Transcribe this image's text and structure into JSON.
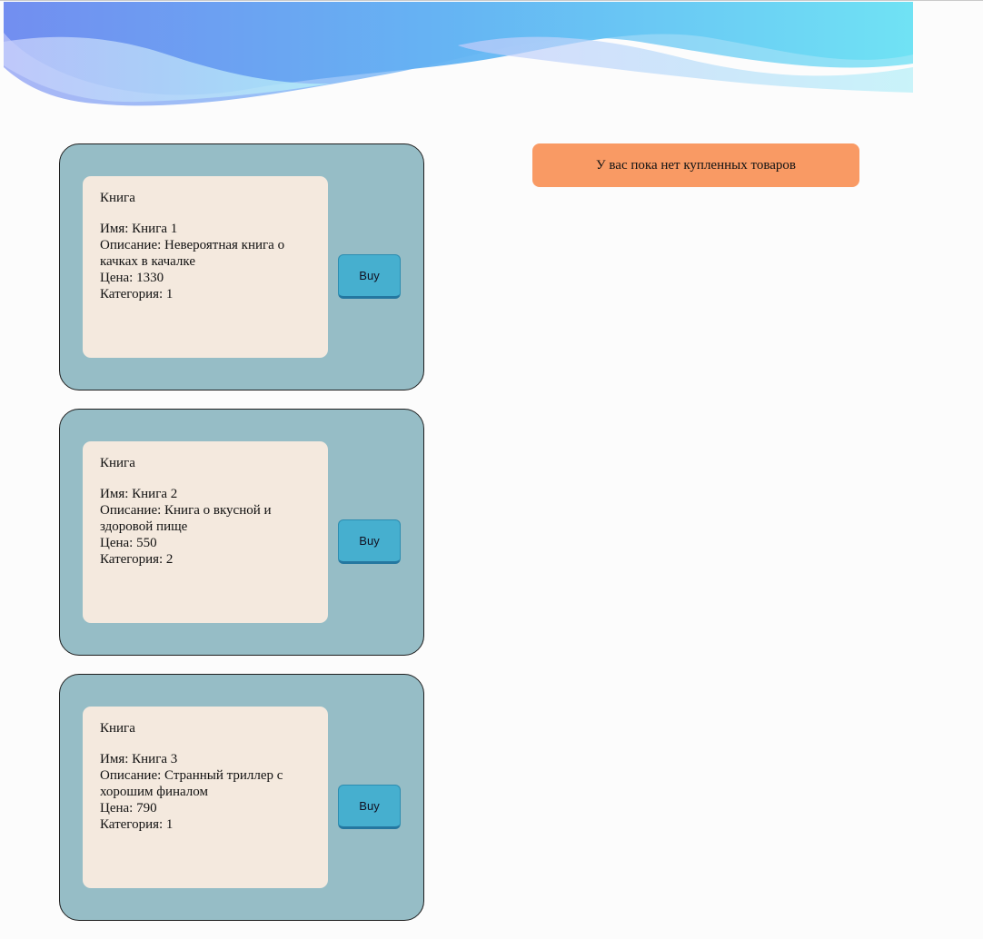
{
  "cart": {
    "empty_message": "У вас пока нет купленных товаров"
  },
  "products": [
    {
      "type": "Книга",
      "name": "Имя: Книга 1",
      "description": "Описание: Невероятная книга о качках в качалке",
      "price": "Цена: 1330",
      "category": "Категория: 1",
      "buy_label": "Buy"
    },
    {
      "type": "Книга",
      "name": "Имя: Книга 2",
      "description": "Описание: Книга о вкусной и здоровой пище",
      "price": "Цена: 550",
      "category": "Категория: 2",
      "buy_label": "Buy"
    },
    {
      "type": "Книга",
      "name": "Имя: Книга 3",
      "description": "Описание: Странный триллер с хорошим финалом",
      "price": "Цена: 790",
      "category": "Категория: 1",
      "buy_label": "Buy"
    }
  ],
  "colors": {
    "card_background": "#96bdc6",
    "info_background": "#f4e9de",
    "button_background": "#46afcf",
    "cart_notice_background": "#f99a64",
    "page_background": "#fcfcfc"
  }
}
